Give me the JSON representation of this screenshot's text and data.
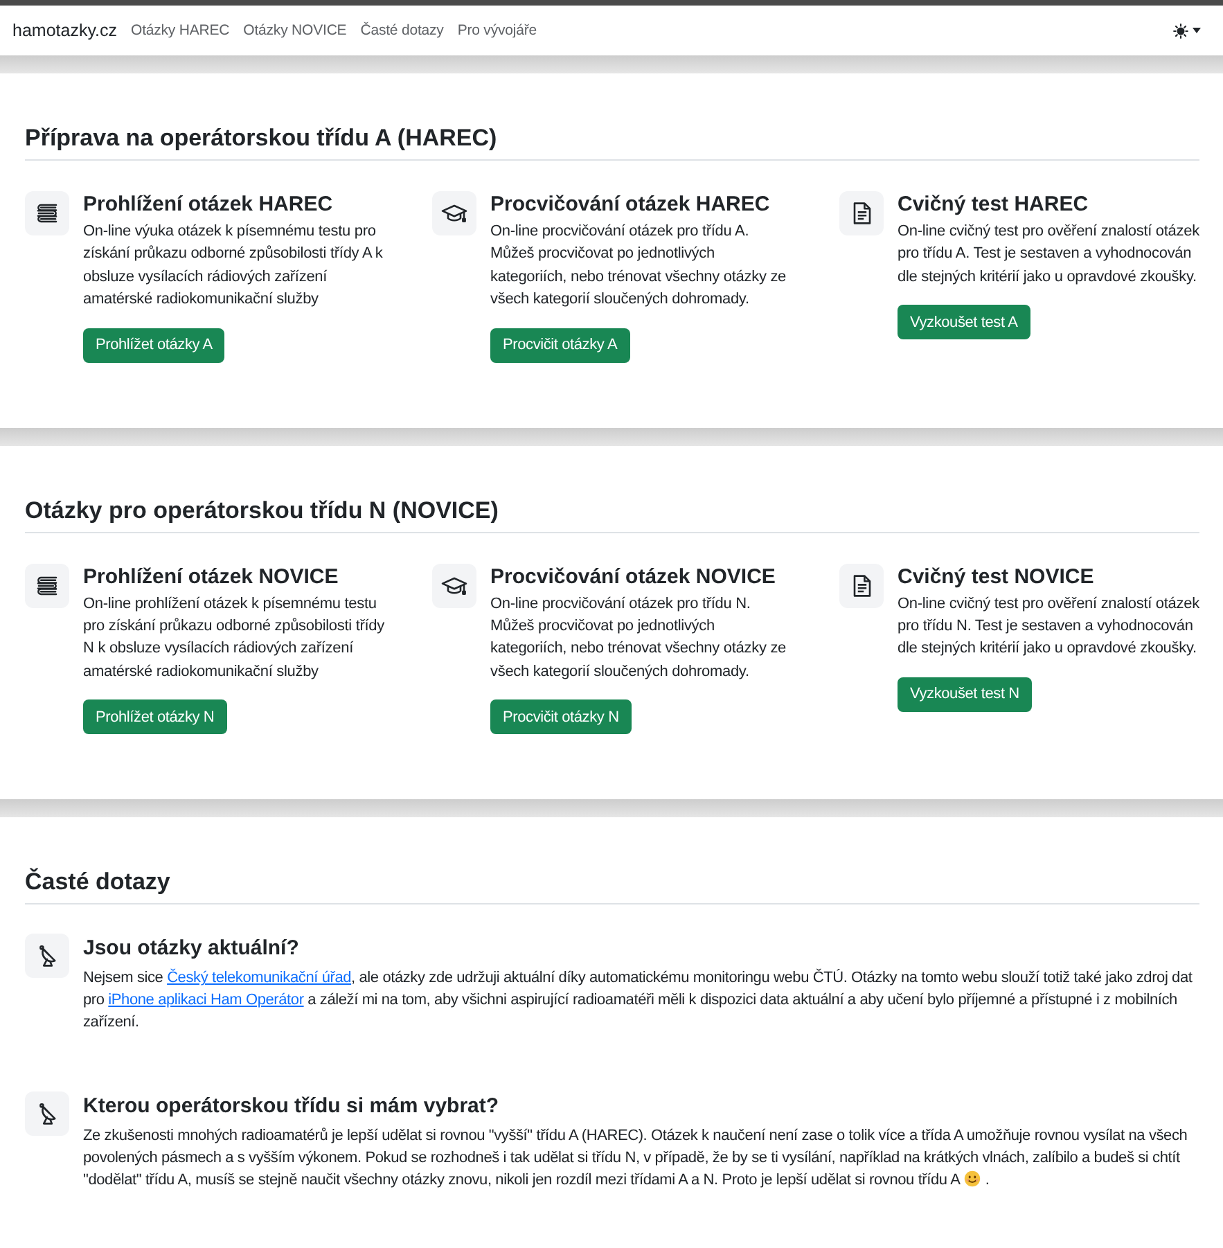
{
  "navbar": {
    "brand": "hamotazky.cz",
    "links": [
      "Otázky HAREC",
      "Otázky NOVICE",
      "Časté dotazy",
      "Pro vývojáře"
    ]
  },
  "sections": [
    {
      "kind": "cards",
      "title": "Příprava na operátorskou třídu A (HAREC)",
      "cards": [
        {
          "kind": "browse",
          "title": "Prohlížení otázek HAREC",
          "text": "On-line výuka otázek k písemnému testu pro získání průkazu odborné způsobilosti třídy A k obsluze vysílacích rádiových zařízení amatérské radiokomunikační služby",
          "button": "Prohlížet otázky A"
        },
        {
          "kind": "practice",
          "title": "Procvičování otázek HAREC",
          "text": "On-line procvičování otázek pro třídu A. Můžeš procvičovat po jednotlivých kategoriích, nebo trénovat všechny otázky ze všech kategorií sloučených dohromady.",
          "button": "Procvičit otázky A"
        },
        {
          "kind": "test",
          "title": "Cvičný test HAREC",
          "text": "On-line cvičný test pro ověření znalostí otázek pro třídu A. Test je sestaven a vyhodnocován dle stejných kritérií jako u opravdové zkoušky.",
          "button": "Vyzkoušet test A"
        }
      ]
    },
    {
      "kind": "cards",
      "title": "Otázky pro operátorskou třídu N (NOVICE)",
      "cards": [
        {
          "kind": "browse",
          "title": "Prohlížení otázek NOVICE",
          "text": "On-line prohlížení otázek k písemnému testu pro získání průkazu odborné způsobilosti třídy N k obsluze vysílacích rádiových zařízení amatérské radiokomunikační služby",
          "button": "Prohlížet otázky N"
        },
        {
          "kind": "practice",
          "title": "Procvičování otázek NOVICE",
          "text": "On-line procvičování otázek pro třídu N. Můžeš procvičovat po jednotlivých kategoriích, nebo trénovat všechny otázky ze všech kategorií sloučených dohromady.",
          "button": "Procvičit otázky N"
        },
        {
          "kind": "test",
          "title": "Cvičný test NOVICE",
          "text": "On-line cvičný test pro ověření znalostí otázek pro třídu N. Test je sestaven a vyhodnocován dle stejných kritérií jako u opravdové zkoušky.",
          "button": "Vyzkoušet test N"
        }
      ]
    },
    {
      "kind": "faq",
      "title": "Časté dotazy",
      "items": [
        {
          "question": "Jsou otázky aktuální?",
          "answer": [
            {
              "kind": "text",
              "text": "Nejsem sice "
            },
            {
              "kind": "link",
              "text": "Český telekomunikační úřad"
            },
            {
              "kind": "text",
              "text": ", ale otázky zde udržuji aktuální díky automatickému monitoringu webu ČTÚ. Otázky na tomto webu slouží totiž také jako zdroj dat pro "
            },
            {
              "kind": "link",
              "text": "iPhone aplikaci Ham Operátor"
            },
            {
              "kind": "text",
              "text": " a záleží mi na tom, aby všichni aspirující radioamatéři měli k dispozici data aktuální a aby učení bylo příjemné a přístupné i z mobilních zařízení."
            }
          ]
        },
        {
          "question": "Kterou operátorskou třídu si mám vybrat?",
          "answer": [
            {
              "kind": "text",
              "text": "Ze zkušenosti mnohých radioamatérů je lepší udělat si rovnou \"vyšší\" třídu A (HAREC). Otázek k naučení není zase o tolik více a třída A umožňuje rovnou vysílat na všech povolených pásmech a s vyšším výkonem. Pokud se rozhodneš i tak udělat si třídu N, v případě, že by se ti vysílání, například na krátkých vlnách, zalíbilo a budeš si chtít \"dodělat\" třídu A, musíš se stejně naučit všechny otázky znovu, nikoli jen rozdíl mezi třídami A a N. Proto je lepší udělat si rovnou třídu A "
            },
            {
              "kind": "emoji"
            },
            {
              "kind": "text",
              "text": " ."
            }
          ]
        }
      ]
    }
  ]
}
